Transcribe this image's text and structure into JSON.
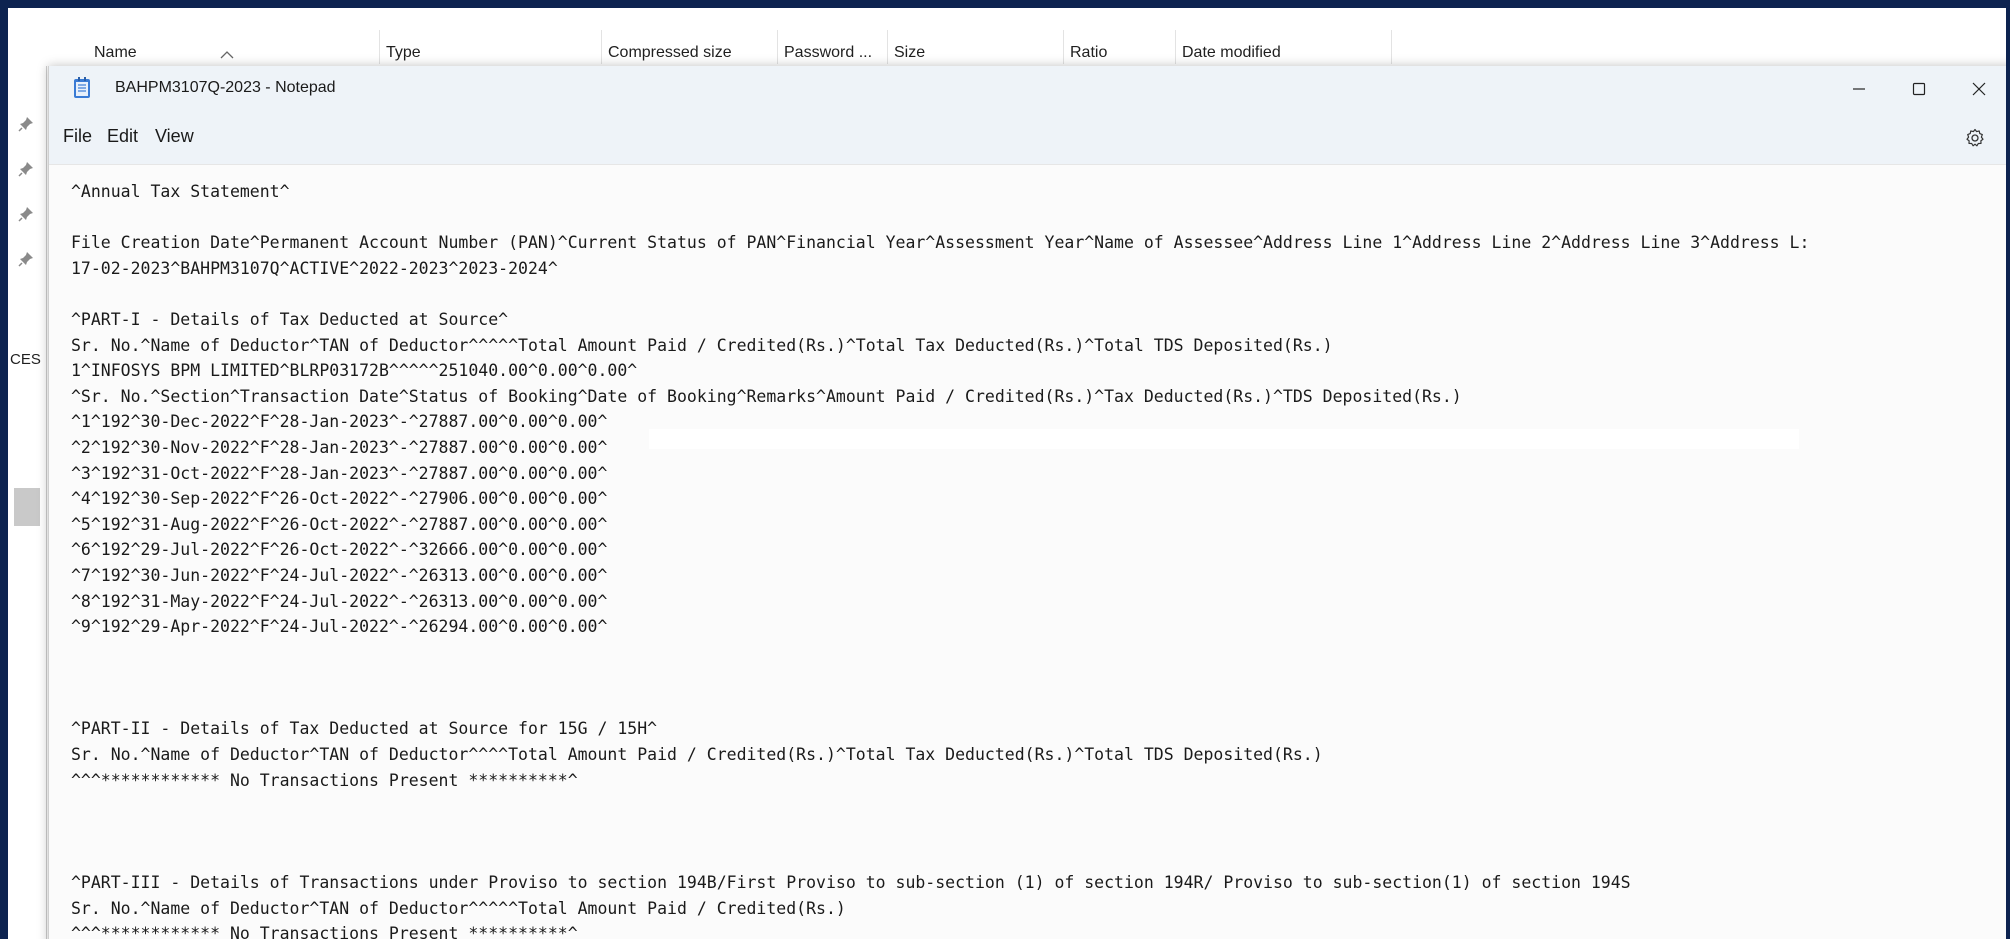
{
  "explorer": {
    "columns": [
      "Name",
      "Type",
      "Compressed size",
      "Password ...",
      "Size",
      "Ratio",
      "Date modified"
    ],
    "rail_label": "CES"
  },
  "notepad": {
    "title": "BAHPM3107Q-2023 - Notepad",
    "menu": [
      "File",
      "Edit",
      "View"
    ],
    "lines": [
      "^Annual Tax Statement^",
      "",
      "File Creation Date^Permanent Account Number (PAN)^Current Status of PAN^Financial Year^Assessment Year^Name of Assessee^Address Line 1^Address Line 2^Address Line 3^Address L:",
      "17-02-2023^BAHPM3107Q^ACTIVE^2022-2023^2023-2024^",
      "",
      "^PART-I - Details of Tax Deducted at Source^",
      "Sr. No.^Name of Deductor^TAN of Deductor^^^^^Total Amount Paid / Credited(Rs.)^Total Tax Deducted(Rs.)^Total TDS Deposited(Rs.)",
      "1^INFOSYS BPM LIMITED^BLRP03172B^^^^^251040.00^0.00^0.00^",
      "^Sr. No.^Section^Transaction Date^Status of Booking^Date of Booking^Remarks^Amount Paid / Credited(Rs.)^Tax Deducted(Rs.)^TDS Deposited(Rs.)",
      "^1^192^30-Dec-2022^F^28-Jan-2023^-^27887.00^0.00^0.00^",
      "^2^192^30-Nov-2022^F^28-Jan-2023^-^27887.00^0.00^0.00^",
      "^3^192^31-Oct-2022^F^28-Jan-2023^-^27887.00^0.00^0.00^",
      "^4^192^30-Sep-2022^F^26-Oct-2022^-^27906.00^0.00^0.00^",
      "^5^192^31-Aug-2022^F^26-Oct-2022^-^27887.00^0.00^0.00^",
      "^6^192^29-Jul-2022^F^26-Oct-2022^-^32666.00^0.00^0.00^",
      "^7^192^30-Jun-2022^F^24-Jul-2022^-^26313.00^0.00^0.00^",
      "^8^192^31-May-2022^F^24-Jul-2022^-^26313.00^0.00^0.00^",
      "^9^192^29-Apr-2022^F^24-Jul-2022^-^26294.00^0.00^0.00^",
      "",
      "",
      "",
      "^PART-II - Details of Tax Deducted at Source for 15G / 15H^",
      "Sr. No.^Name of Deductor^TAN of Deductor^^^^Total Amount Paid / Credited(Rs.)^Total Tax Deducted(Rs.)^Total TDS Deposited(Rs.)",
      "^^^************ No Transactions Present **********^",
      "",
      "",
      "",
      "^PART-III - Details of Transactions under Proviso to section 194B/First Proviso to sub-section (1) of section 194R/ Proviso to sub-section(1) of section 194S",
      "Sr. No.^Name of Deductor^TAN of Deductor^^^^^Total Amount Paid / Credited(Rs.)",
      "^^^************ No Transactions Present **********^"
    ]
  },
  "icons": {
    "app": "notepad-icon",
    "minimize": "minimize-icon",
    "maximize": "maximize-icon",
    "close": "close-icon",
    "settings": "gear-icon",
    "pin": "pin-icon"
  },
  "colors": {
    "desktop_border": "#0d2350",
    "titlebar": "#eef3f8",
    "editor_bg": "#fbfbfb"
  }
}
